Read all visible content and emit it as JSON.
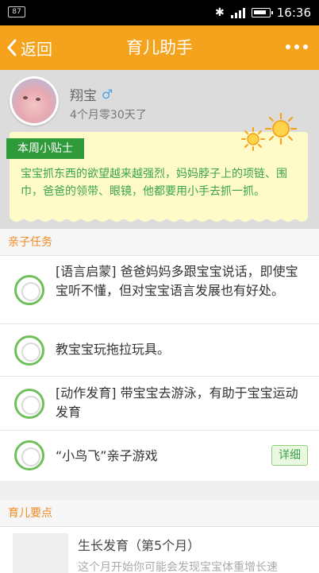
{
  "status": {
    "badge": "87",
    "time": "16:36"
  },
  "header": {
    "back_label": "返回",
    "title": "育儿助手"
  },
  "profile": {
    "name": "翔宝",
    "gender_icon": "male-symbol-icon",
    "age": "4个月零30天了"
  },
  "tips": {
    "label": "本周小贴士",
    "text": "宝宝抓东西的欲望越来越强烈，妈妈脖子上的项链、围巾，爸爸的领带、眼镜，他都要用小手去抓一抓。"
  },
  "tasks": {
    "heading": "亲子任务",
    "items": [
      {
        "text": "[语言启蒙] 爸爸妈妈多跟宝宝说话，即使宝宝听不懂，但对宝宝语言发展也有好处。"
      },
      {
        "text": "教宝宝玩拖拉玩具。"
      },
      {
        "text": "[动作发育] 带宝宝去游泳，有助于宝宝运动发育"
      },
      {
        "text": "“小鸟飞”亲子游戏",
        "button": "详细"
      }
    ]
  },
  "essentials": {
    "heading": "育儿要点",
    "items": [
      {
        "title": "生长发育（第5个月）",
        "subtitle": "这个月开始你可能会发现宝宝体重增长速"
      }
    ]
  },
  "colors": {
    "accent": "#f5a21c",
    "green": "#3aa34a",
    "section_title": "#f08a24"
  }
}
